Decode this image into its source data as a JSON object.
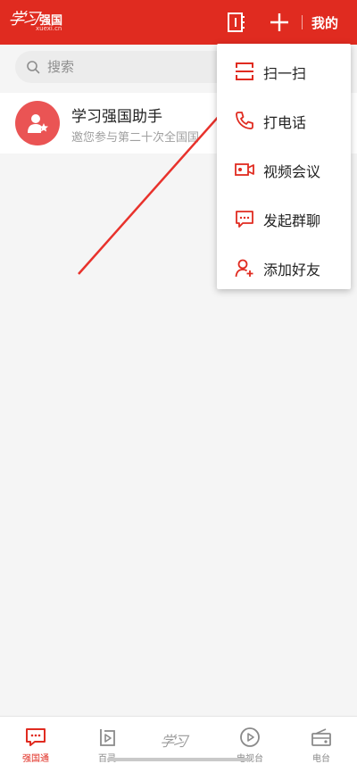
{
  "header": {
    "logo_calligraphy": "学习",
    "logo_name": "强国",
    "logo_domain": "xuexi.cn",
    "mine_label": "我的"
  },
  "search": {
    "placeholder": "搜索"
  },
  "conversations": [
    {
      "title": "学习强国助手",
      "preview": "邀您参与第二十次全国国"
    }
  ],
  "dropdown_menu": {
    "items": [
      {
        "label": "扫一扫",
        "icon": "scan-icon"
      },
      {
        "label": "打电话",
        "icon": "phone-icon"
      },
      {
        "label": "视频会议",
        "icon": "video-camera-icon"
      },
      {
        "label": "发起群聊",
        "icon": "chat-bubble-icon"
      },
      {
        "label": "添加好友",
        "icon": "add-friend-icon"
      }
    ]
  },
  "bottom_nav": {
    "items": [
      {
        "label": "强国通",
        "icon": "chat-icon",
        "active": true
      },
      {
        "label": "百灵",
        "icon": "bailing-play-icon",
        "active": false
      },
      {
        "label": "",
        "icon": "xuexi-logo-icon",
        "active": false
      },
      {
        "label": "电视台",
        "icon": "tv-play-icon",
        "active": false
      },
      {
        "label": "电台",
        "icon": "radio-icon",
        "active": false
      }
    ],
    "center_calligraphy": "学习"
  },
  "colors": {
    "brand_red": "#e02b20",
    "avatar_red": "#ea5454",
    "annotation_arrow": "#e8322c"
  }
}
